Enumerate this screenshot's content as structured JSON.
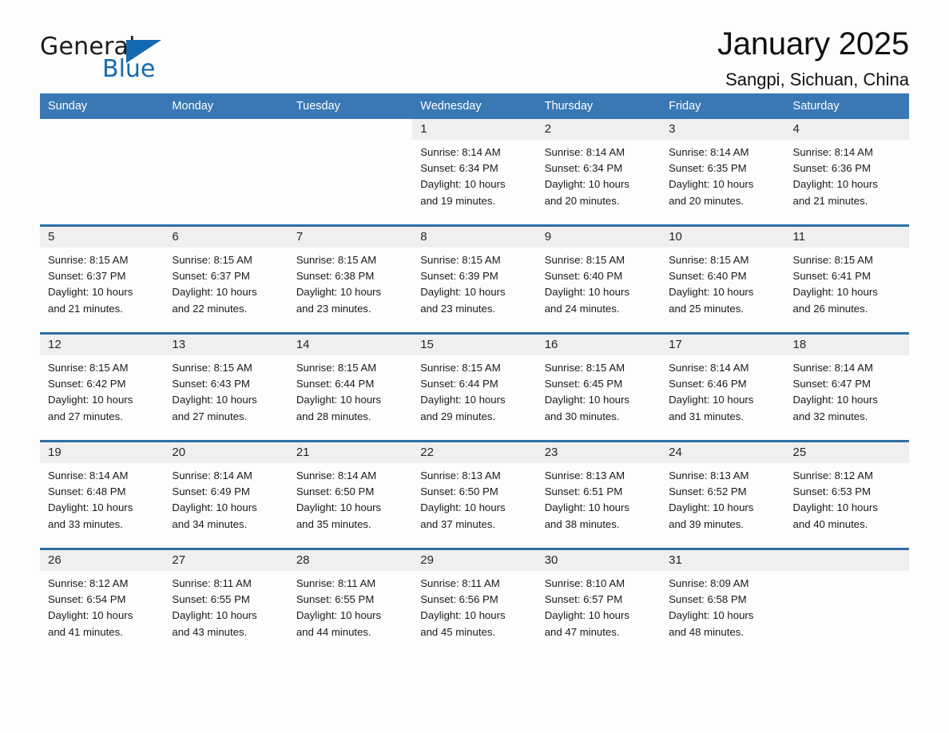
{
  "brand": {
    "name_part1": "General",
    "name_part2": "Blue",
    "triangle_icon": "blue-triangle-logo-mark",
    "accent_color": "#1569b0"
  },
  "header": {
    "title": "January 2025",
    "subtitle": "Sangpi, Sichuan, China"
  },
  "colors": {
    "header_blue": "#3a78b5",
    "row_border_blue": "#2e6da4",
    "daynum_band": "#efefef",
    "page_background": "#fdfdfd"
  },
  "weekday_headers": [
    "Sunday",
    "Monday",
    "Tuesday",
    "Wednesday",
    "Thursday",
    "Friday",
    "Saturday"
  ],
  "labels": {
    "sunrise_prefix": "Sunrise:",
    "sunset_prefix": "Sunset:",
    "daylight_prefix": "Daylight:"
  },
  "weeks": [
    [
      {
        "day": "",
        "blank": true
      },
      {
        "day": "",
        "blank": true
      },
      {
        "day": "",
        "blank": true
      },
      {
        "day": "1",
        "sunrise": "Sunrise: 8:14 AM",
        "sunset": "Sunset: 6:34 PM",
        "daylight_line1": "Daylight: 10 hours",
        "daylight_line2": "and 19 minutes."
      },
      {
        "day": "2",
        "sunrise": "Sunrise: 8:14 AM",
        "sunset": "Sunset: 6:34 PM",
        "daylight_line1": "Daylight: 10 hours",
        "daylight_line2": "and 20 minutes."
      },
      {
        "day": "3",
        "sunrise": "Sunrise: 8:14 AM",
        "sunset": "Sunset: 6:35 PM",
        "daylight_line1": "Daylight: 10 hours",
        "daylight_line2": "and 20 minutes."
      },
      {
        "day": "4",
        "sunrise": "Sunrise: 8:14 AM",
        "sunset": "Sunset: 6:36 PM",
        "daylight_line1": "Daylight: 10 hours",
        "daylight_line2": "and 21 minutes."
      }
    ],
    [
      {
        "day": "5",
        "sunrise": "Sunrise: 8:15 AM",
        "sunset": "Sunset: 6:37 PM",
        "daylight_line1": "Daylight: 10 hours",
        "daylight_line2": "and 21 minutes."
      },
      {
        "day": "6",
        "sunrise": "Sunrise: 8:15 AM",
        "sunset": "Sunset: 6:37 PM",
        "daylight_line1": "Daylight: 10 hours",
        "daylight_line2": "and 22 minutes."
      },
      {
        "day": "7",
        "sunrise": "Sunrise: 8:15 AM",
        "sunset": "Sunset: 6:38 PM",
        "daylight_line1": "Daylight: 10 hours",
        "daylight_line2": "and 23 minutes."
      },
      {
        "day": "8",
        "sunrise": "Sunrise: 8:15 AM",
        "sunset": "Sunset: 6:39 PM",
        "daylight_line1": "Daylight: 10 hours",
        "daylight_line2": "and 23 minutes."
      },
      {
        "day": "9",
        "sunrise": "Sunrise: 8:15 AM",
        "sunset": "Sunset: 6:40 PM",
        "daylight_line1": "Daylight: 10 hours",
        "daylight_line2": "and 24 minutes."
      },
      {
        "day": "10",
        "sunrise": "Sunrise: 8:15 AM",
        "sunset": "Sunset: 6:40 PM",
        "daylight_line1": "Daylight: 10 hours",
        "daylight_line2": "and 25 minutes."
      },
      {
        "day": "11",
        "sunrise": "Sunrise: 8:15 AM",
        "sunset": "Sunset: 6:41 PM",
        "daylight_line1": "Daylight: 10 hours",
        "daylight_line2": "and 26 minutes."
      }
    ],
    [
      {
        "day": "12",
        "sunrise": "Sunrise: 8:15 AM",
        "sunset": "Sunset: 6:42 PM",
        "daylight_line1": "Daylight: 10 hours",
        "daylight_line2": "and 27 minutes."
      },
      {
        "day": "13",
        "sunrise": "Sunrise: 8:15 AM",
        "sunset": "Sunset: 6:43 PM",
        "daylight_line1": "Daylight: 10 hours",
        "daylight_line2": "and 27 minutes."
      },
      {
        "day": "14",
        "sunrise": "Sunrise: 8:15 AM",
        "sunset": "Sunset: 6:44 PM",
        "daylight_line1": "Daylight: 10 hours",
        "daylight_line2": "and 28 minutes."
      },
      {
        "day": "15",
        "sunrise": "Sunrise: 8:15 AM",
        "sunset": "Sunset: 6:44 PM",
        "daylight_line1": "Daylight: 10 hours",
        "daylight_line2": "and 29 minutes."
      },
      {
        "day": "16",
        "sunrise": "Sunrise: 8:15 AM",
        "sunset": "Sunset: 6:45 PM",
        "daylight_line1": "Daylight: 10 hours",
        "daylight_line2": "and 30 minutes."
      },
      {
        "day": "17",
        "sunrise": "Sunrise: 8:14 AM",
        "sunset": "Sunset: 6:46 PM",
        "daylight_line1": "Daylight: 10 hours",
        "daylight_line2": "and 31 minutes."
      },
      {
        "day": "18",
        "sunrise": "Sunrise: 8:14 AM",
        "sunset": "Sunset: 6:47 PM",
        "daylight_line1": "Daylight: 10 hours",
        "daylight_line2": "and 32 minutes."
      }
    ],
    [
      {
        "day": "19",
        "sunrise": "Sunrise: 8:14 AM",
        "sunset": "Sunset: 6:48 PM",
        "daylight_line1": "Daylight: 10 hours",
        "daylight_line2": "and 33 minutes."
      },
      {
        "day": "20",
        "sunrise": "Sunrise: 8:14 AM",
        "sunset": "Sunset: 6:49 PM",
        "daylight_line1": "Daylight: 10 hours",
        "daylight_line2": "and 34 minutes."
      },
      {
        "day": "21",
        "sunrise": "Sunrise: 8:14 AM",
        "sunset": "Sunset: 6:50 PM",
        "daylight_line1": "Daylight: 10 hours",
        "daylight_line2": "and 35 minutes."
      },
      {
        "day": "22",
        "sunrise": "Sunrise: 8:13 AM",
        "sunset": "Sunset: 6:50 PM",
        "daylight_line1": "Daylight: 10 hours",
        "daylight_line2": "and 37 minutes."
      },
      {
        "day": "23",
        "sunrise": "Sunrise: 8:13 AM",
        "sunset": "Sunset: 6:51 PM",
        "daylight_line1": "Daylight: 10 hours",
        "daylight_line2": "and 38 minutes."
      },
      {
        "day": "24",
        "sunrise": "Sunrise: 8:13 AM",
        "sunset": "Sunset: 6:52 PM",
        "daylight_line1": "Daylight: 10 hours",
        "daylight_line2": "and 39 minutes."
      },
      {
        "day": "25",
        "sunrise": "Sunrise: 8:12 AM",
        "sunset": "Sunset: 6:53 PM",
        "daylight_line1": "Daylight: 10 hours",
        "daylight_line2": "and 40 minutes."
      }
    ],
    [
      {
        "day": "26",
        "sunrise": "Sunrise: 8:12 AM",
        "sunset": "Sunset: 6:54 PM",
        "daylight_line1": "Daylight: 10 hours",
        "daylight_line2": "and 41 minutes."
      },
      {
        "day": "27",
        "sunrise": "Sunrise: 8:11 AM",
        "sunset": "Sunset: 6:55 PM",
        "daylight_line1": "Daylight: 10 hours",
        "daylight_line2": "and 43 minutes."
      },
      {
        "day": "28",
        "sunrise": "Sunrise: 8:11 AM",
        "sunset": "Sunset: 6:55 PM",
        "daylight_line1": "Daylight: 10 hours",
        "daylight_line2": "and 44 minutes."
      },
      {
        "day": "29",
        "sunrise": "Sunrise: 8:11 AM",
        "sunset": "Sunset: 6:56 PM",
        "daylight_line1": "Daylight: 10 hours",
        "daylight_line2": "and 45 minutes."
      },
      {
        "day": "30",
        "sunrise": "Sunrise: 8:10 AM",
        "sunset": "Sunset: 6:57 PM",
        "daylight_line1": "Daylight: 10 hours",
        "daylight_line2": "and 47 minutes."
      },
      {
        "day": "31",
        "sunrise": "Sunrise: 8:09 AM",
        "sunset": "Sunset: 6:58 PM",
        "daylight_line1": "Daylight: 10 hours",
        "daylight_line2": "and 48 minutes."
      },
      {
        "day": "",
        "empty": true
      }
    ]
  ]
}
